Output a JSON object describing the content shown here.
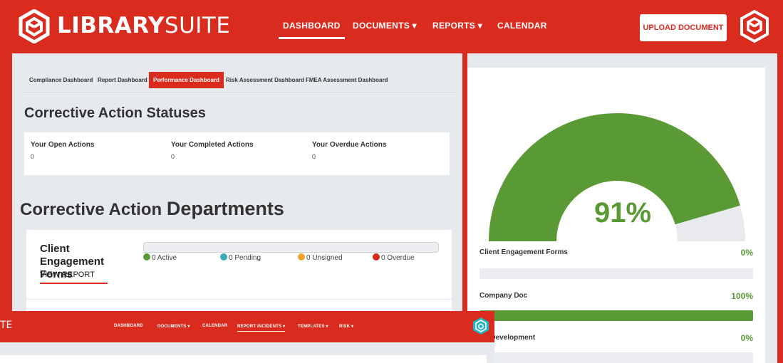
{
  "brand": {
    "bold": "LIBRARY",
    "light": "SUITE"
  },
  "nav": [
    {
      "label": "DASHBOARD",
      "active": true
    },
    {
      "label": "DOCUMENTS ▾",
      "active": false
    },
    {
      "label": "REPORTS ▾",
      "active": false
    },
    {
      "label": "CALENDAR",
      "active": false
    }
  ],
  "upload_button": "UPLOAD DOCUMENT",
  "tabs": [
    {
      "label": "Compliance Dashboard",
      "active": false
    },
    {
      "label": "Report Dashboard",
      "active": false
    },
    {
      "label": "Performance Dashboard",
      "active": true
    },
    {
      "label": "Risk Assessment Dashboard",
      "active": false
    },
    {
      "label": "FMEA Assessment Dashboard",
      "active": false
    }
  ],
  "statuses": {
    "title": "Corrective Action Statuses",
    "items": [
      {
        "label": "Your Open Actions",
        "value": "0"
      },
      {
        "label": "Your Completed Actions",
        "value": "0"
      },
      {
        "label": "Your Overdue Actions",
        "value": "0"
      }
    ]
  },
  "departments": {
    "title_part1": "Corrective Action",
    "title_part2": "Departments",
    "card": {
      "title": "Client Engagement Forms",
      "view_report": "VIEW REPORT",
      "legend": [
        {
          "label": "0 Active",
          "color": "#5a9a34"
        },
        {
          "label": "0 Pending",
          "color": "#3aaab8"
        },
        {
          "label": "0 Unsigned",
          "color": "#f2a12c"
        },
        {
          "label": "0 Overdue",
          "color": "#d42a1e"
        }
      ]
    }
  },
  "gauge": {
    "percent_label": "91%",
    "value": 0.91,
    "color": "#5a9a34"
  },
  "dept_progress": [
    {
      "label": "Client Engagement Forms",
      "pct": "0%",
      "fill": 0
    },
    {
      "label": "Company Doc",
      "pct": "100%",
      "fill": 1
    },
    {
      "label": "AT Development",
      "pct": "0%",
      "fill": 0
    }
  ],
  "overlay": {
    "logo_text": "TE",
    "nav": [
      {
        "label": "DASHBOARD",
        "active": false
      },
      {
        "label": "DOCUMENTS ▾",
        "active": false
      },
      {
        "label": "CALENDAR",
        "active": false
      },
      {
        "label": "REPORT INCIDENTS ▾",
        "active": true
      },
      {
        "label": "TEMPLATES ▾",
        "active": false
      },
      {
        "label": "RISK ▾",
        "active": false
      }
    ]
  },
  "colors": {
    "brand_red": "#da2b1f",
    "accent_green": "#5a9a34"
  }
}
